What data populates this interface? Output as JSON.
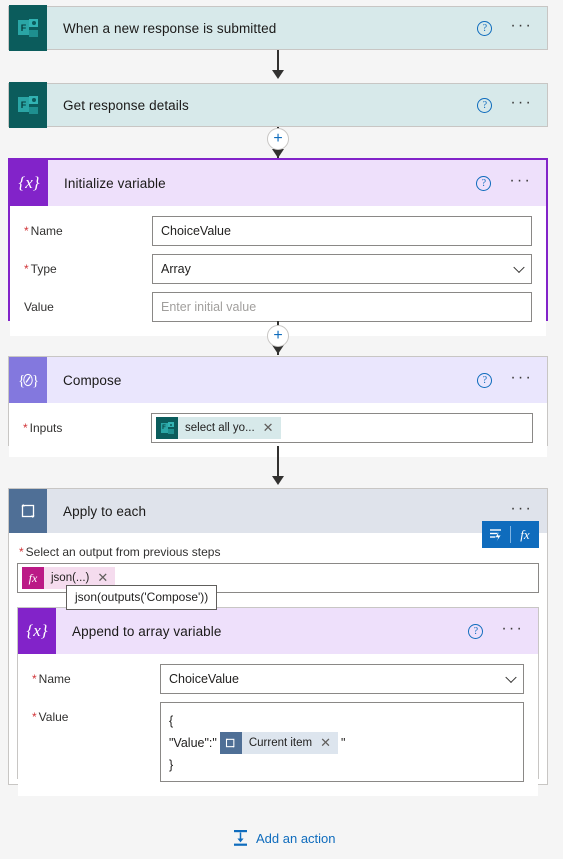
{
  "flow": {
    "trigger": {
      "title": "When a new response is submitted",
      "icon": "microsoft-forms-icon",
      "help_label": "?",
      "menu_label": "···"
    },
    "steps": [
      {
        "id": "get-response-details",
        "title": "Get response details",
        "icon": "microsoft-forms-icon"
      },
      {
        "id": "initialize-variable",
        "title": "Initialize variable",
        "icon": "variable-braces-icon",
        "selected": true,
        "fields": [
          {
            "label": "Name",
            "required": true,
            "value": "ChoiceValue",
            "placeholder": "",
            "control": "text"
          },
          {
            "label": "Type",
            "required": true,
            "value": "Array",
            "placeholder": "",
            "control": "dropdown"
          },
          {
            "label": "Value",
            "required": false,
            "value": "",
            "placeholder": "Enter initial value",
            "control": "text"
          }
        ]
      },
      {
        "id": "compose",
        "title": "Compose",
        "icon": "compose-pencil-icon",
        "fields": [
          {
            "label": "Inputs",
            "required": true,
            "control": "token"
          }
        ],
        "input_token": {
          "text": "select all yo...",
          "icon": "microsoft-forms-icon",
          "remove": "✕"
        }
      }
    ],
    "scope": {
      "id": "apply-to-each",
      "title": "Apply to each",
      "icon": "loop-icon",
      "menu_label": "···",
      "select_output_label": "Select an output from previous steps",
      "select_output_required": true,
      "output_token": {
        "text": "json(...)",
        "icon": "fx-icon",
        "remove": "✕"
      },
      "tooltip": "json(outputs('Compose'))",
      "dynamic_content_button": "dynamic-content-icon",
      "expression_button": "fx",
      "inner_action": {
        "id": "append-to-array-variable",
        "title": "Append to array variable",
        "icon": "variable-braces-icon",
        "fields": [
          {
            "label": "Name",
            "required": true,
            "value": "ChoiceValue",
            "control": "dropdown"
          },
          {
            "label": "Value",
            "required": true,
            "control": "multiline"
          }
        ],
        "value_lines": {
          "line1": "{",
          "line2_prefix": "\"Value\":\"",
          "line2_suffix": "\"",
          "line3": "}"
        },
        "value_token": {
          "text": "Current item",
          "icon": "loop-icon",
          "remove": "✕"
        }
      }
    },
    "footer": {
      "add_action_label": "Add an action",
      "add_action_icon": "insert-below-icon"
    },
    "icon_glyphs": {
      "variable": "{x}",
      "compose": "{∕}",
      "forms_letter": "F",
      "plus": "+",
      "help": "?"
    },
    "colors": {
      "accent_blue": "#0f6cbd",
      "variable_purple": "#8223c9",
      "variable_bg": "#eee0fb",
      "compose_purple": "#8378de",
      "compose_bg": "#eae6fd",
      "forms_teal": "#0b5c5c",
      "forms_bg": "#d7e9ea",
      "scope_slate": "#4f6f96",
      "scope_bg": "#dfe3eb",
      "fx_magenta": "#bb1a86",
      "canvas_bg": "#f5f5f5",
      "required_red": "#d13438"
    }
  }
}
